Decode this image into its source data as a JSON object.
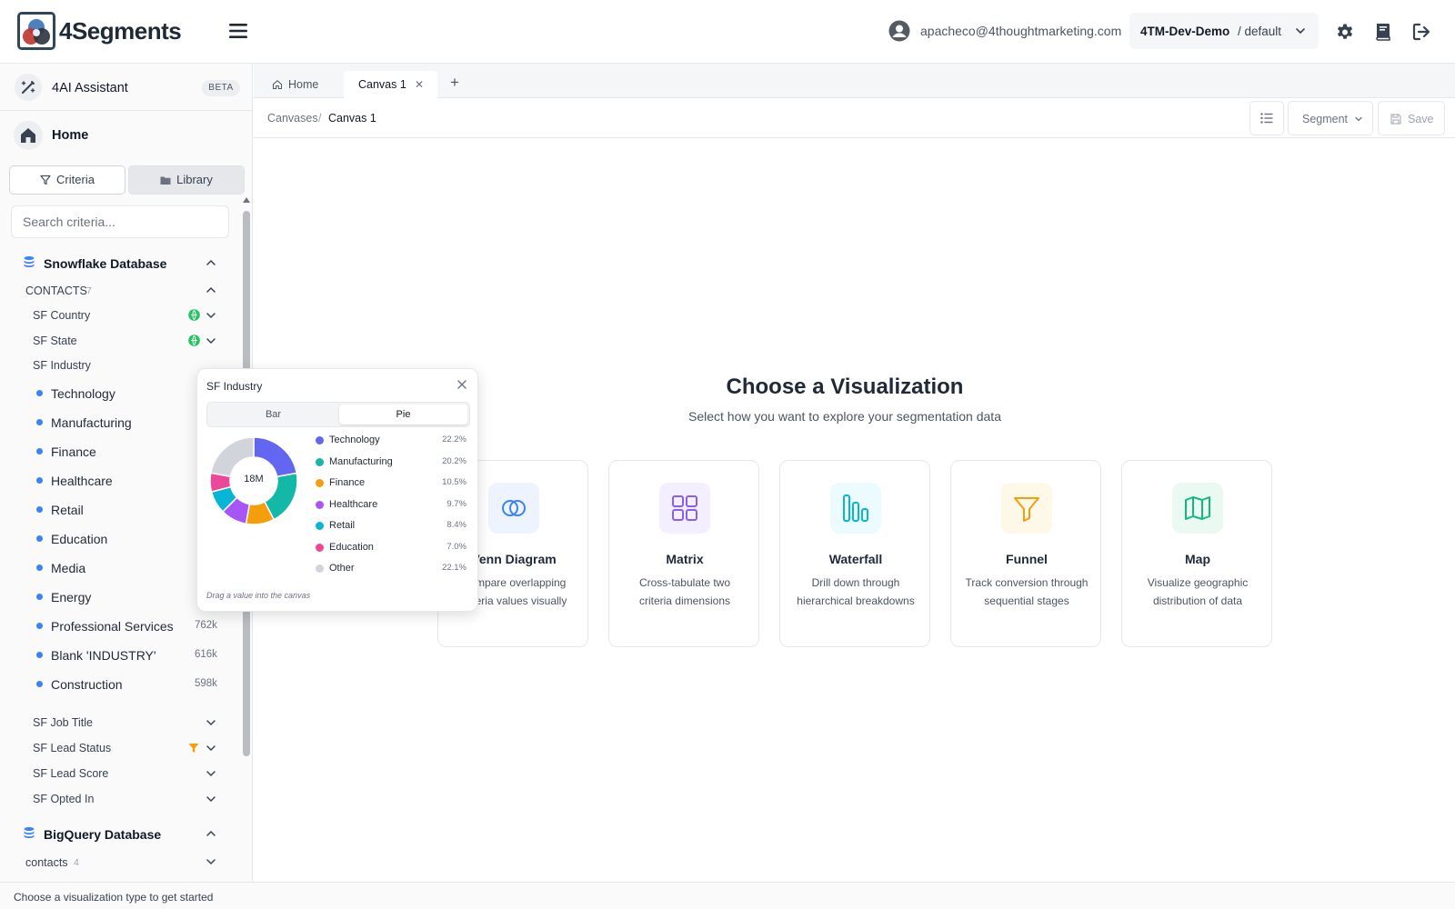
{
  "app": {
    "name": "4Segments"
  },
  "header": {
    "email": "apacheco@4thoughtmarketing.com",
    "workspace": "4TM-Dev-Demo",
    "environment": "/ default"
  },
  "sidebar": {
    "assistant_label": "4AI Assistant",
    "assistant_badge": "BETA",
    "home_label": "Home",
    "tabs": {
      "criteria": "Criteria",
      "library": "Library"
    },
    "search_placeholder": "Search criteria...",
    "databases": [
      {
        "name": "Snowflake Database",
        "tables": [
          {
            "name": "CONTACTS",
            "count": "7",
            "fields": [
              {
                "name": "SF Country"
              },
              {
                "name": "SF State"
              },
              {
                "name": "SF Industry"
              },
              {
                "name": "SF Job Title"
              },
              {
                "name": "SF Lead Status"
              },
              {
                "name": "SF Lead Score"
              },
              {
                "name": "SF Opted In"
              }
            ]
          }
        ]
      },
      {
        "name": "BigQuery Database",
        "tables": [
          {
            "name": "contacts",
            "count": "4"
          }
        ]
      }
    ],
    "industry_values": [
      {
        "label": "Technology",
        "count": ""
      },
      {
        "label": "Manufacturing",
        "count": ""
      },
      {
        "label": "Finance",
        "count": ""
      },
      {
        "label": "Healthcare",
        "count": ""
      },
      {
        "label": "Retail",
        "count": ""
      },
      {
        "label": "Education",
        "count": ""
      },
      {
        "label": "Media",
        "count": ""
      },
      {
        "label": "Energy",
        "count": ""
      },
      {
        "label": "Professional Services",
        "count": "762k"
      },
      {
        "label": "Blank 'INDUSTRY'",
        "count": "616k"
      },
      {
        "label": "Construction",
        "count": "598k"
      }
    ]
  },
  "tabs": {
    "home": "Home",
    "canvas": "Canvas 1",
    "add": "+"
  },
  "breadcrumb": {
    "root": "Canvases",
    "separator": "/",
    "current": "Canvas 1"
  },
  "toolbar": {
    "segment": "Segment",
    "save": "Save"
  },
  "canvas": {
    "title": "Choose a Visualization",
    "subtitle": "Select how you want to explore your segmentation data",
    "cards": [
      {
        "title": "Venn Diagram",
        "desc": "Compare overlapping criteria values visually",
        "icon": "venn-icon",
        "color": "#3b82f6",
        "bg": "#eef4ff"
      },
      {
        "title": "Matrix",
        "desc": "Cross-tabulate two criteria dimensions",
        "icon": "grid-icon",
        "color": "#8b5cf6",
        "bg": "#f3effe"
      },
      {
        "title": "Waterfall",
        "desc": "Drill down through hierarchical breakdowns",
        "icon": "bars-icon",
        "color": "#06b6d4",
        "bg": "#ecfbfd"
      },
      {
        "title": "Funnel",
        "desc": "Track conversion through sequential stages",
        "icon": "funnel-icon",
        "color": "#f59e0b",
        "bg": "#fef8e8"
      },
      {
        "title": "Map",
        "desc": "Visualize geographic distribution of data",
        "icon": "map-icon",
        "color": "#10b981",
        "bg": "#eafaf3"
      }
    ]
  },
  "popup": {
    "title": "SF Industry",
    "toggle": {
      "bar": "Bar",
      "pie": "Pie",
      "selected": "Pie"
    },
    "hint": "Drag a value into the canvas"
  },
  "chart_data": {
    "type": "pie",
    "center_label": "18M",
    "slices": [
      {
        "label": "Technology",
        "value": 22.2,
        "pct": "22.2%",
        "color": "#6366f1"
      },
      {
        "label": "Manufacturing",
        "value": 20.2,
        "pct": "20.2%",
        "color": "#14b8a6"
      },
      {
        "label": "Finance",
        "value": 10.5,
        "pct": "10.5%",
        "color": "#f59e0b"
      },
      {
        "label": "Healthcare",
        "value": 9.7,
        "pct": "9.7%",
        "color": "#a855f7"
      },
      {
        "label": "Retail",
        "value": 8.4,
        "pct": "8.4%",
        "color": "#06b6d4"
      },
      {
        "label": "Education",
        "value": 7.0,
        "pct": "7.0%",
        "color": "#ec4899"
      },
      {
        "label": "Other",
        "value": 22.1,
        "pct": "22.1%",
        "color": "#d1d5db"
      }
    ]
  },
  "status": {
    "text": "Choose a visualization type to get started"
  },
  "colors": {
    "accent": "#3b82f6",
    "check": "#22c55e",
    "filter": "#f59e0b"
  }
}
